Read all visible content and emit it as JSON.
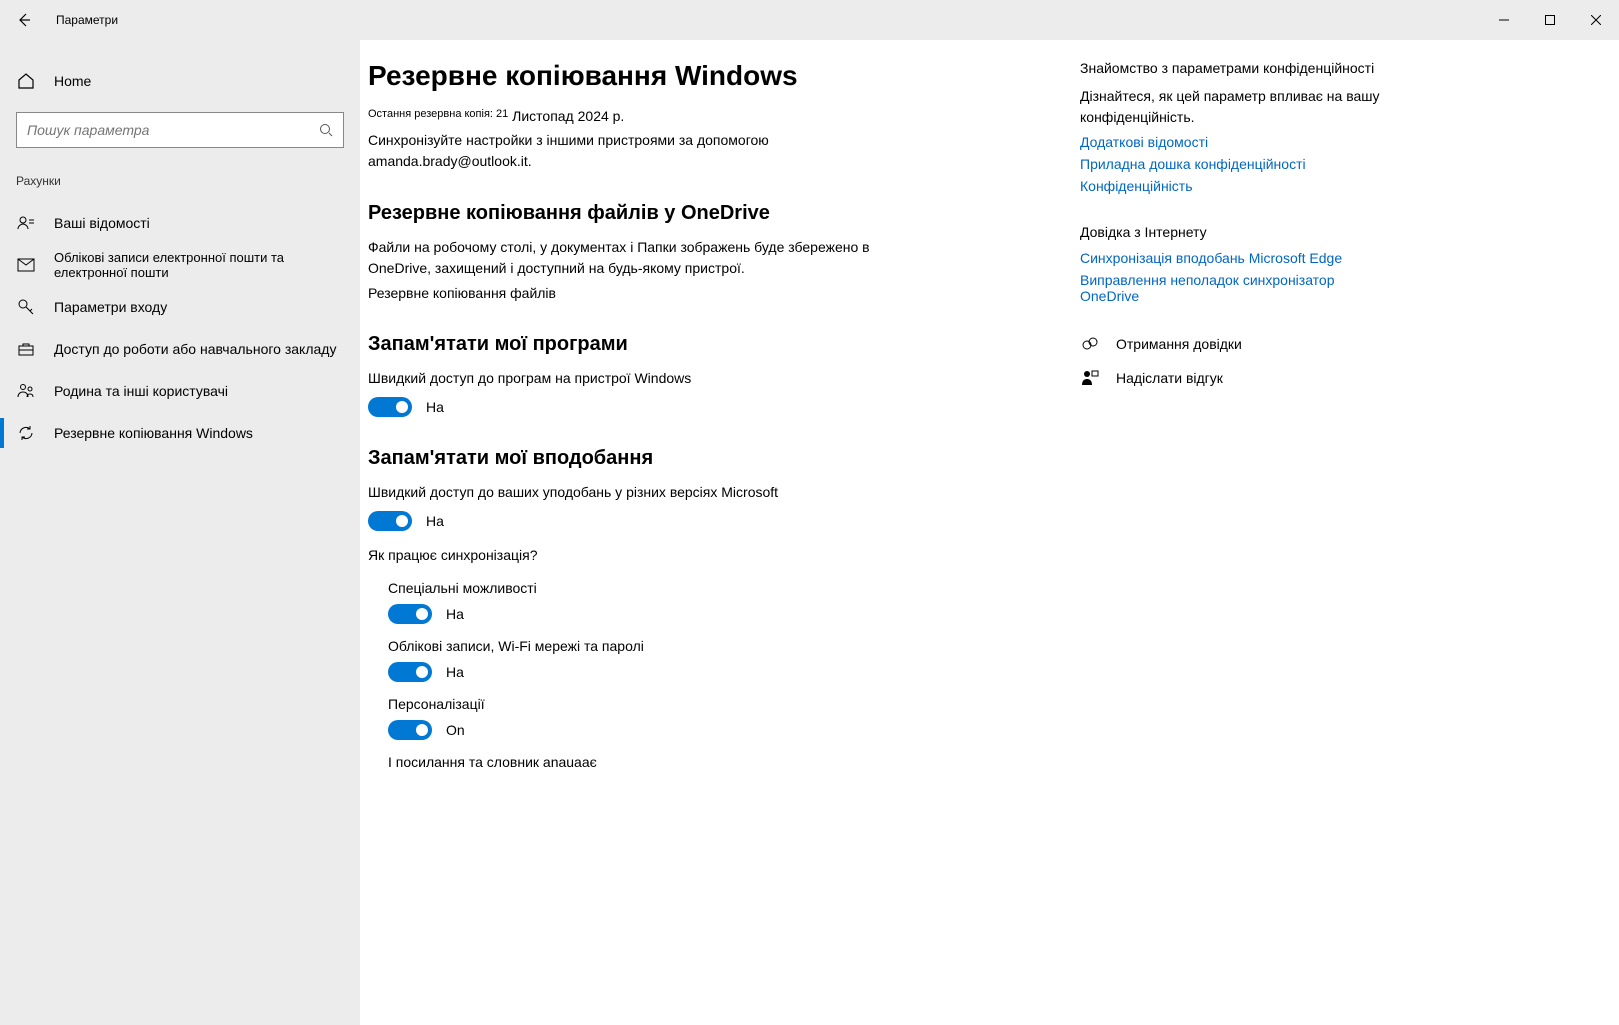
{
  "window": {
    "title": "Параметри"
  },
  "sidebar": {
    "home": "Home",
    "search_placeholder": "Пошук параметра",
    "category": "Рахунки",
    "items": [
      {
        "label": "Ваші відомості"
      },
      {
        "label": "Облікові записи електронної пошти та електронної пошти"
      },
      {
        "label": "Параметри входу"
      },
      {
        "label": "Доступ до роботи або навчального закладу"
      },
      {
        "label": "Родина та інші користувачі"
      },
      {
        "label": "Резервне копіювання Windows"
      }
    ]
  },
  "main": {
    "title": "Резервне копіювання Windows",
    "last_backup_label": "Остання резервна копія: 21",
    "last_backup_value": "Листопад 2024 р.",
    "sync_line": "Синхронізуйте настройки з іншими пристроями за допомогою amanda.brady@outlook.it.",
    "onedrive_heading": "Резервне копіювання файлів у OneDrive",
    "onedrive_desc": "Файли на робочому столі, у документах і    Папки зображень буде збережено в OneDrive, захищений і доступний на будь-якому пристрої.",
    "onedrive_link": "Резервне копіювання файлів",
    "apps_heading": "Запам'ятати мої програми",
    "apps_desc": "Швидкий доступ до програм на пристрої Windows",
    "apps_toggle": "На",
    "prefs_heading": "Запам'ятати мої вподобання",
    "prefs_desc": "Швидкий доступ до ваших уподобань у різних версіях Microsoft",
    "prefs_toggle": "На",
    "how_sync": "Як працює синхронізація?",
    "subs": [
      {
        "title": "Спеціальні можливості",
        "state": "На"
      },
      {
        "title": "Облікові записи, Wi-Fi мережі та паролі",
        "state": "На"
      },
      {
        "title": "Персоналізації",
        "state": "On"
      },
      {
        "title": "І посилання та словник anauaaє",
        "state": ""
      }
    ]
  },
  "right": {
    "privacy_heading": "Знайомство з параметрами конфіденційності",
    "privacy_desc": "Дізнайтеся, як цей параметр впливає на вашу конфіденційність.",
    "links1": [
      "Додаткові відомості",
      "Приладна дошка конфіденційності",
      "Конфіденційність"
    ],
    "help_heading": "Довідка з Інтернету",
    "links2": [
      "Синхронізація вподобань Microsoft Edge",
      "Виправлення неполадок синхронізатор OneDrive"
    ],
    "get_help": "Отримання довідки",
    "feedback": "Надіслати відгук"
  }
}
